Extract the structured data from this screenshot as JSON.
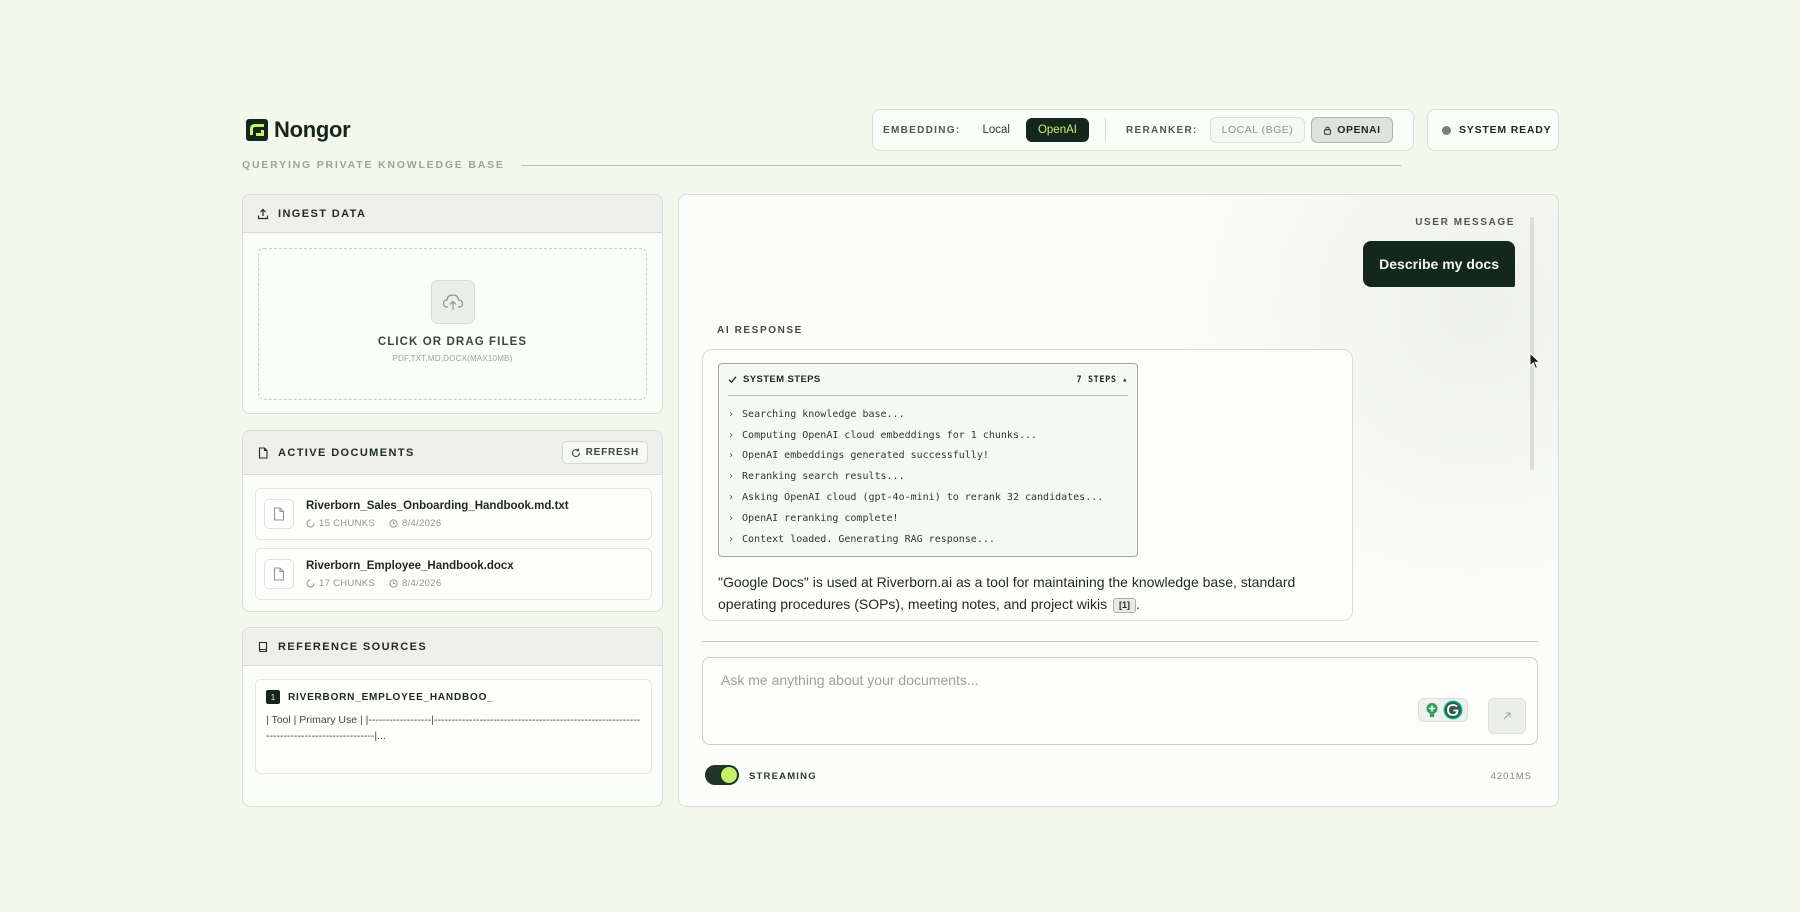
{
  "app": {
    "name": "Nongor",
    "subtitle": "QUERYING PRIVATE KNOWLEDGE BASE"
  },
  "colors": {
    "accent": "#c6f26b",
    "dark": "#13271c",
    "background": "#f3f8ec"
  },
  "models": {
    "embedding_label": "EMBEDDING:",
    "embedding_options": [
      "Local",
      "OpenAI"
    ],
    "embedding_selected": "OpenAI",
    "reranker_label": "RERANKER:",
    "reranker_options": [
      "LOCAL (BGE)",
      "OPENAI"
    ],
    "reranker_selected": "OPENAI"
  },
  "status": {
    "text": "SYSTEM READY"
  },
  "ingest": {
    "title": "INGEST DATA",
    "drop_title": "CLICK OR DRAG FILES",
    "drop_sub": "PDF,TXT,MD,DOCX(MAX10MB)"
  },
  "documents": {
    "title": "ACTIVE DOCUMENTS",
    "refresh_label": "REFRESH",
    "items": [
      {
        "name": "Riverborn_Sales_Onboarding_Handbook.md.txt",
        "chunks": "15 CHUNKS",
        "date": "8/4/2026"
      },
      {
        "name": "Riverborn_Employee_Handbook.docx",
        "chunks": "17 CHUNKS",
        "date": "8/4/2026"
      }
    ]
  },
  "references": {
    "title": "REFERENCE SOURCES",
    "items": [
      {
        "num": "1",
        "name": "RIVERBORN_EMPLOYEE_HANDBOO_",
        "text": "| Tool | Primary Use | |------------------|------------------------------------------------------------------------------------------|..."
      }
    ]
  },
  "chat": {
    "user_label": "USER MESSAGE",
    "user_message": "Describe my docs",
    "ai_label": "AI RESPONSE",
    "steps_title": "SYSTEM STEPS",
    "steps_count": "7 STEPS ▴",
    "steps": [
      "Searching knowledge base...",
      "Computing OpenAI cloud embeddings for 1 chunks...",
      "OpenAI embeddings generated successfully!",
      "Reranking search results...",
      "Asking OpenAI cloud (gpt-4o-mini) to rerank 32 candidates...",
      "OpenAI reranking complete!",
      "Context loaded. Generating RAG response..."
    ],
    "answer": "\"Google Docs\" is used at Riverborn.ai as a tool for maintaining the knowledge base, standard operating procedures (SOPs), meeting notes, and project wikis",
    "citation": "[1]",
    "answer_end": ".",
    "input_placeholder": "Ask me anything about your documents...",
    "streaming_label": "STREAMING",
    "streaming_on": true,
    "latency": "4201MS"
  }
}
